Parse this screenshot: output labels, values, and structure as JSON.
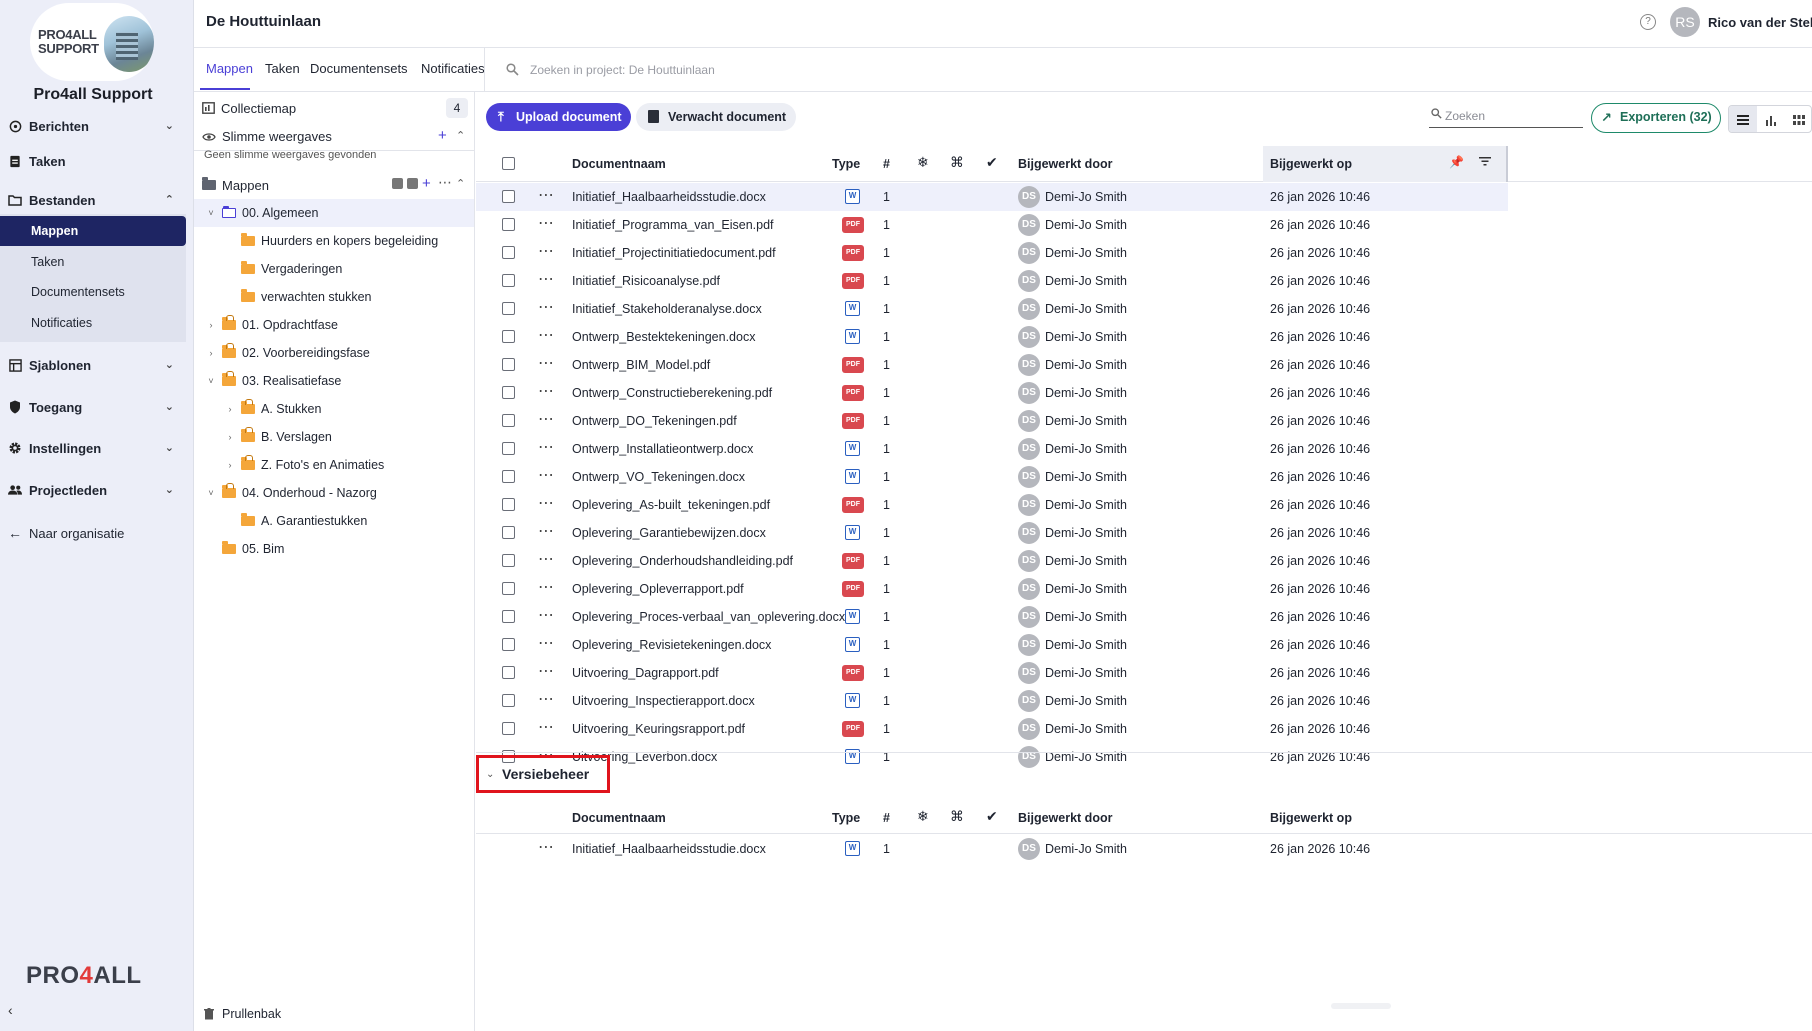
{
  "sidebar": {
    "logo": {
      "line1": "PRO4ALL",
      "line2": "SUPPORT"
    },
    "brand": "Pro4all Support",
    "items": [
      {
        "label": "Berichten",
        "icon": "message-icon"
      },
      {
        "label": "Taken",
        "icon": "clipboard-icon"
      },
      {
        "label": "Bestanden",
        "icon": "folder-icon",
        "expanded": true
      },
      {
        "label": "Sjablonen",
        "icon": "template-icon"
      },
      {
        "label": "Toegang",
        "icon": "shield-icon"
      },
      {
        "label": "Instellingen",
        "icon": "gear-icon"
      },
      {
        "label": "Projectleden",
        "icon": "people-icon"
      },
      {
        "label": "Naar organisatie",
        "icon": "arrow-left-icon"
      }
    ],
    "sub_items": [
      "Mappen",
      "Taken",
      "Documentensets",
      "Notificaties"
    ],
    "bottom_logo": {
      "pre": "PRO",
      "four": "4",
      "post": "ALL"
    }
  },
  "header": {
    "project_title": "De Houttuinlaan",
    "user_initials": "RS",
    "user_name": "Rico van der Stelt"
  },
  "tabs": [
    "Mappen",
    "Taken",
    "Documentensets",
    "Notificaties"
  ],
  "search": {
    "placeholder": "Zoeken in project: De Houttuinlaan"
  },
  "tree": {
    "collection": {
      "label": "Collectiemap",
      "count": "4"
    },
    "smart_views": {
      "label": "Slimme weergaves",
      "empty": "Geen slimme weergaves gevonden"
    },
    "folders_label": "Mappen",
    "folders": [
      {
        "label": "00. Algemeen",
        "depth": 0,
        "chevron": "down",
        "kind": "open",
        "selected": true
      },
      {
        "label": "Huurders en kopers begeleiding",
        "depth": 1,
        "chevron": "",
        "kind": "plain"
      },
      {
        "label": "Vergaderingen",
        "depth": 1,
        "chevron": "",
        "kind": "plain"
      },
      {
        "label": "verwachten stukken",
        "depth": 1,
        "chevron": "",
        "kind": "plain"
      },
      {
        "label": "01. Opdrachtfase",
        "depth": 0,
        "chevron": "right",
        "kind": "lock"
      },
      {
        "label": "02. Voorbereidingsfase",
        "depth": 0,
        "chevron": "right",
        "kind": "lock"
      },
      {
        "label": "03. Realisatiefase",
        "depth": 0,
        "chevron": "down",
        "kind": "lock"
      },
      {
        "label": "A. Stukken",
        "depth": 1,
        "chevron": "right",
        "kind": "lock"
      },
      {
        "label": "B. Verslagen",
        "depth": 1,
        "chevron": "right",
        "kind": "lock"
      },
      {
        "label": "Z. Foto's en Animaties",
        "depth": 1,
        "chevron": "right",
        "kind": "lock"
      },
      {
        "label": "04. Onderhoud - Nazorg",
        "depth": 0,
        "chevron": "down",
        "kind": "lock"
      },
      {
        "label": "A. Garantiestukken",
        "depth": 1,
        "chevron": "",
        "kind": "plain"
      },
      {
        "label": "05. Bim",
        "depth": 0,
        "chevron": "",
        "kind": "plain"
      }
    ],
    "trash": "Prullenbak"
  },
  "toolbar": {
    "upload": "Upload document",
    "expected": "Verwacht document",
    "filter_placeholder": "Zoeken",
    "export": "Exporteren (32)"
  },
  "table": {
    "headers": {
      "name": "Documentnaam",
      "type": "Type",
      "count": "#",
      "updated_by": "Bijgewerkt door",
      "updated_on": "Bijgewerkt op"
    },
    "rows": [
      {
        "name": "Initiatief_Haalbaarheidsstudie.docx",
        "type": "docx",
        "n": "1",
        "initials": "DS",
        "by": "Demi-Jo Smith",
        "date": "26 jan 2026 10:46"
      },
      {
        "name": "Initiatief_Programma_van_Eisen.pdf",
        "type": "pdf",
        "n": "1",
        "initials": "DS",
        "by": "Demi-Jo Smith",
        "date": "26 jan 2026 10:46"
      },
      {
        "name": "Initiatief_Projectinitiatiedocument.pdf",
        "type": "pdf",
        "n": "1",
        "initials": "DS",
        "by": "Demi-Jo Smith",
        "date": "26 jan 2026 10:46"
      },
      {
        "name": "Initiatief_Risicoanalyse.pdf",
        "type": "pdf",
        "n": "1",
        "initials": "DS",
        "by": "Demi-Jo Smith",
        "date": "26 jan 2026 10:46"
      },
      {
        "name": "Initiatief_Stakeholderanalyse.docx",
        "type": "docx",
        "n": "1",
        "initials": "DS",
        "by": "Demi-Jo Smith",
        "date": "26 jan 2026 10:46"
      },
      {
        "name": "Ontwerp_Bestektekeningen.docx",
        "type": "docx",
        "n": "1",
        "initials": "DS",
        "by": "Demi-Jo Smith",
        "date": "26 jan 2026 10:46"
      },
      {
        "name": "Ontwerp_BIM_Model.pdf",
        "type": "pdf",
        "n": "1",
        "initials": "DS",
        "by": "Demi-Jo Smith",
        "date": "26 jan 2026 10:46"
      },
      {
        "name": "Ontwerp_Constructieberekening.pdf",
        "type": "pdf",
        "n": "1",
        "initials": "DS",
        "by": "Demi-Jo Smith",
        "date": "26 jan 2026 10:46"
      },
      {
        "name": "Ontwerp_DO_Tekeningen.pdf",
        "type": "pdf",
        "n": "1",
        "initials": "DS",
        "by": "Demi-Jo Smith",
        "date": "26 jan 2026 10:46"
      },
      {
        "name": "Ontwerp_Installatieontwerp.docx",
        "type": "docx",
        "n": "1",
        "initials": "DS",
        "by": "Demi-Jo Smith",
        "date": "26 jan 2026 10:46"
      },
      {
        "name": "Ontwerp_VO_Tekeningen.docx",
        "type": "docx",
        "n": "1",
        "initials": "DS",
        "by": "Demi-Jo Smith",
        "date": "26 jan 2026 10:46"
      },
      {
        "name": "Oplevering_As-built_tekeningen.pdf",
        "type": "pdf",
        "n": "1",
        "initials": "DS",
        "by": "Demi-Jo Smith",
        "date": "26 jan 2026 10:46"
      },
      {
        "name": "Oplevering_Garantiebewijzen.docx",
        "type": "docx",
        "n": "1",
        "initials": "DS",
        "by": "Demi-Jo Smith",
        "date": "26 jan 2026 10:46"
      },
      {
        "name": "Oplevering_Onderhoudshandleiding.pdf",
        "type": "pdf",
        "n": "1",
        "initials": "DS",
        "by": "Demi-Jo Smith",
        "date": "26 jan 2026 10:46"
      },
      {
        "name": "Oplevering_Opleverrapport.pdf",
        "type": "pdf",
        "n": "1",
        "initials": "DS",
        "by": "Demi-Jo Smith",
        "date": "26 jan 2026 10:46"
      },
      {
        "name": "Oplevering_Proces-verbaal_van_oplevering.docx",
        "type": "docx",
        "n": "1",
        "initials": "DS",
        "by": "Demi-Jo Smith",
        "date": "26 jan 2026 10:46"
      },
      {
        "name": "Oplevering_Revisietekeningen.docx",
        "type": "docx",
        "n": "1",
        "initials": "DS",
        "by": "Demi-Jo Smith",
        "date": "26 jan 2026 10:46"
      },
      {
        "name": "Uitvoering_Dagrapport.pdf",
        "type": "pdf",
        "n": "1",
        "initials": "DS",
        "by": "Demi-Jo Smith",
        "date": "26 jan 2026 10:46"
      },
      {
        "name": "Uitvoering_Inspectierapport.docx",
        "type": "docx",
        "n": "1",
        "initials": "DS",
        "by": "Demi-Jo Smith",
        "date": "26 jan 2026 10:46"
      },
      {
        "name": "Uitvoering_Keuringsrapport.pdf",
        "type": "pdf",
        "n": "1",
        "initials": "DS",
        "by": "Demi-Jo Smith",
        "date": "26 jan 2026 10:46"
      },
      {
        "name": "Uitvoering_Leverbon.docx",
        "type": "docx",
        "n": "1",
        "initials": "DS",
        "by": "Demi-Jo Smith",
        "date": "26 jan 2026 10:46"
      }
    ]
  },
  "version_panel": {
    "title": "Versiebeheer",
    "rows": [
      {
        "name": "Initiatief_Haalbaarheidsstudie.docx",
        "type": "docx",
        "n": "1",
        "initials": "DS",
        "by": "Demi-Jo Smith",
        "date": "26 jan 2026 10:46"
      }
    ]
  },
  "colors": {
    "accent": "#4a3fd6",
    "nav_active": "#1e2563",
    "export": "#1e8a6a",
    "pdf": "#d9484f",
    "docx": "#2a5fc0",
    "highlight_box": "#e0141c"
  }
}
